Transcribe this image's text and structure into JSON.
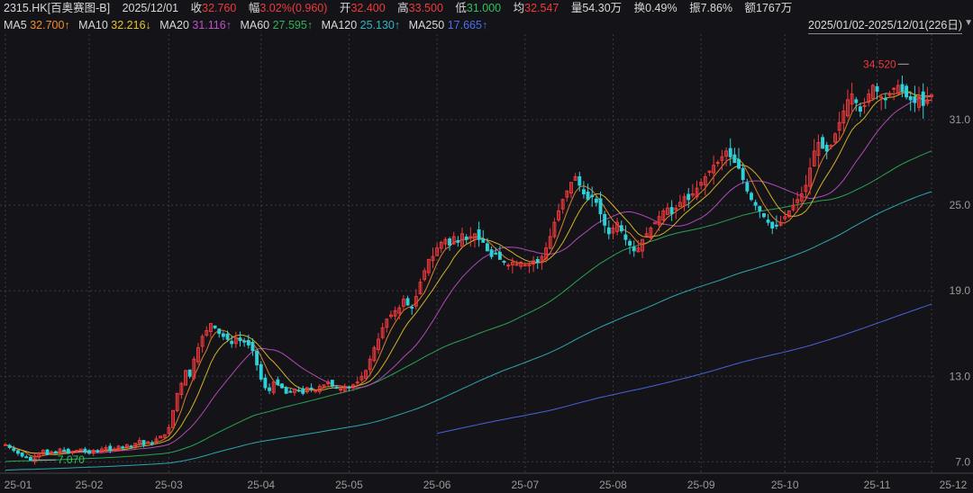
{
  "header": {
    "ticker": "2315.HK[百奥赛图-B]",
    "date": "2025/12/01",
    "close_label": "收",
    "close": "32.760",
    "change_label": "幅",
    "change": "3.02%(0.960)",
    "open_label": "开",
    "open": "32.400",
    "high_label": "高",
    "high": "33.500",
    "low_label": "低",
    "low": "31.000",
    "avg_label": "均",
    "avg": "32.547",
    "volume": "量54.30万",
    "turnover": "换0.49%",
    "amplitude": "振7.86%",
    "amount": "额1767万"
  },
  "moving_averages": [
    {
      "name": "MA5",
      "value": "32.700↑",
      "color": "#f28c28"
    },
    {
      "name": "MA10",
      "value": "32.216↓",
      "color": "#e6c229"
    },
    {
      "name": "MA20",
      "value": "31.116↑",
      "color": "#c04fc8"
    },
    {
      "name": "MA60",
      "value": "27.595↑",
      "color": "#2bb35a"
    },
    {
      "name": "MA120",
      "value": "25.130↑",
      "color": "#2fb5c0"
    },
    {
      "name": "MA250",
      "value": "17.665↑",
      "color": "#4a6cf0"
    }
  ],
  "date_range": "2025/01/02-2025/12/01(226日)",
  "chart_data": {
    "type": "candlestick",
    "ylim": [
      6.2,
      37.0
    ],
    "y_ticks": [
      "31.0",
      "25.0",
      "19.0",
      "13.0",
      "7.0"
    ],
    "y_tick_values": [
      31,
      25,
      19,
      13,
      7
    ],
    "x_ticks": [
      "25-01",
      "25-02",
      "25-03",
      "25-04",
      "25-05",
      "25-06",
      "25-07",
      "25-08",
      "25-09",
      "25-10",
      "25-11",
      "25-12"
    ],
    "x_tick_index": [
      0,
      20,
      39,
      61,
      82,
      103,
      124,
      145,
      166,
      186,
      208,
      226
    ],
    "annotations": [
      {
        "text": "34.520",
        "index": 216,
        "value": 34.52,
        "color": "#f0393c"
      },
      {
        "text": "7.070",
        "index": 6,
        "value": 7.07,
        "color": "#2bc45f"
      }
    ],
    "close": [
      8.2,
      8.0,
      7.8,
      7.6,
      7.4,
      7.3,
      7.1,
      7.4,
      7.6,
      7.8,
      7.5,
      7.7,
      7.6,
      7.9,
      7.8,
      7.6,
      7.7,
      7.8,
      7.9,
      7.7,
      7.6,
      7.8,
      7.7,
      7.9,
      8.0,
      7.8,
      7.9,
      8.1,
      8.0,
      8.2,
      8.1,
      8.3,
      8.5,
      8.2,
      8.4,
      8.3,
      8.6,
      8.8,
      8.9,
      9.4,
      10.6,
      11.8,
      12.5,
      13.4,
      13.0,
      14.2,
      15.0,
      15.8,
      16.2,
      16.7,
      16.4,
      16.0,
      15.8,
      15.6,
      15.3,
      15.7,
      15.5,
      15.4,
      15.2,
      14.8,
      13.8,
      12.8,
      12.2,
      12.0,
      12.6,
      12.4,
      12.2,
      11.8,
      11.9,
      12.1,
      12.0,
      11.8,
      12.2,
      12.1,
      12.0,
      12.3,
      12.4,
      12.6,
      12.3,
      12.2,
      12.1,
      12.3,
      12.2,
      12.4,
      12.6,
      13.0,
      13.4,
      14.2,
      15.0,
      15.6,
      16.4,
      17.0,
      17.3,
      17.6,
      17.8,
      18.4,
      18.0,
      17.8,
      18.6,
      19.6,
      20.4,
      21.2,
      21.4,
      22.0,
      22.4,
      22.6,
      22.2,
      22.8,
      22.4,
      23.0,
      22.6,
      22.8,
      23.0,
      22.6,
      22.4,
      21.8,
      21.4,
      21.6,
      21.2,
      21.0,
      20.8,
      21.0,
      20.9,
      21.0,
      20.8,
      20.9,
      21.1,
      21.0,
      21.4,
      22.0,
      22.8,
      23.8,
      24.6,
      25.4,
      26.0,
      26.6,
      27.0,
      26.4,
      25.8,
      25.4,
      25.6,
      25.2,
      24.4,
      23.6,
      23.0,
      23.4,
      23.8,
      23.2,
      22.6,
      22.2,
      21.8,
      22.0,
      22.6,
      23.0,
      23.4,
      23.8,
      24.2,
      24.6,
      24.8,
      24.4,
      24.8,
      25.2,
      25.6,
      25.4,
      25.8,
      26.2,
      26.6,
      27.0,
      27.4,
      27.8,
      28.0,
      28.4,
      28.8,
      28.4,
      28.0,
      27.6,
      26.8,
      26.0,
      25.4,
      25.0,
      24.6,
      24.2,
      23.8,
      23.4,
      23.6,
      23.8,
      24.2,
      24.6,
      25.0,
      25.4,
      25.8,
      26.4,
      27.6,
      28.8,
      29.4,
      29.0,
      28.8,
      29.2,
      30.0,
      30.8,
      31.6,
      32.4,
      32.8,
      32.2,
      31.6,
      32.0,
      32.8,
      33.4,
      33.0,
      32.6,
      32.4,
      32.8,
      33.2,
      33.4,
      33.0,
      32.6,
      32.4,
      32.2,
      32.6,
      32.0,
      32.4,
      32.76
    ],
    "series": [
      {
        "name": "MA5",
        "color": "#f28c28",
        "lag": 5,
        "upto": 1.0
      },
      {
        "name": "MA10",
        "color": "#e6c229",
        "lag": 10,
        "upto": 1.0
      },
      {
        "name": "MA20",
        "color": "#c04fc8",
        "lag": 20,
        "upto": 1.0
      },
      {
        "name": "MA60",
        "color": "#2bb35a",
        "lag": 60,
        "upto": 1.0
      },
      {
        "name": "MA120",
        "color": "#2fb5c0",
        "lag": 120,
        "upto": 1.0
      },
      {
        "name": "MA250",
        "color": "#4a6cf0",
        "lag": 250,
        "upto": 1.0
      }
    ],
    "up_color": "#f0393c",
    "down_color": "#2fd0d8",
    "grid": true,
    "grid_color": "#3a3a44"
  }
}
